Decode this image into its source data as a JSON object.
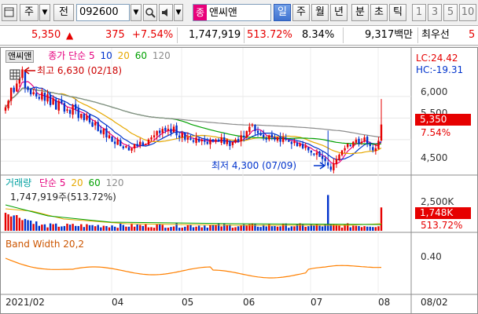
{
  "toolbar": {
    "window_icon": "chart-window-icon",
    "chart_type_label": "주",
    "market_label": "전",
    "stock_code": "092600",
    "search_icon": "magnifier-icon",
    "sound_icon": "speaker-icon",
    "badge": "종",
    "stock_name": "앤씨앤",
    "periods": [
      "일",
      "주",
      "월",
      "년",
      "분",
      "초",
      "틱"
    ],
    "selected_period": "일",
    "minute_options": [
      "1",
      "3",
      "5",
      "10"
    ]
  },
  "info": {
    "price": "5,350",
    "change_arrow": "▲",
    "change": "375",
    "change_pct": "+7.54%",
    "volume": "1,747,919",
    "volume_ratio": "513.72%",
    "turnover": "8.34%",
    "amount": "9,317백만",
    "priority_label": "최우선",
    "priority_value": "5"
  },
  "price_panel": {
    "stock_tag": "앤씨앤",
    "legend_prefix": "종가 단순",
    "ma_periods": [
      "5",
      "10",
      "20",
      "60",
      "120"
    ],
    "ma_colors": [
      "#e6007e",
      "#0033cc",
      "#e6a800",
      "#00a000",
      "#8c8c8c"
    ],
    "high_note": "최고 6,630 (02/18)",
    "low_note": "최저 4,300 (07/09)",
    "lc": "LC:24.42",
    "hc": "HC:-19.31",
    "axis_ticks": [
      "6,000",
      "5,500",
      "4,500"
    ],
    "current_price": "5,350",
    "current_pct": "7.54%"
  },
  "volume_panel": {
    "title": "거래량",
    "legend_prefix": "단순",
    "ma_periods": [
      "5",
      "20",
      "60",
      "120"
    ],
    "current_volume_label": "1,747,919주(513.72%)",
    "axis_tick": "2,500K",
    "current_volume_tag": "1,748K",
    "current_ratio": "513.72%"
  },
  "bandwidth_panel": {
    "title": "Band Width 20,2",
    "axis_tick": "0.40"
  },
  "x_axis": {
    "labels": [
      "2021/02",
      "04",
      "05",
      "06",
      "07",
      "08",
      "08/02"
    ]
  },
  "colors": {
    "up": "#e60000",
    "down": "#0033cc",
    "selected_period_bg": "#3f72d0",
    "price_tag_bg": "#e60000",
    "bandwidth_line": "#ff8000"
  },
  "chart_data": [
    {
      "type": "candlestick",
      "name": "price",
      "x_range": [
        "2021/02",
        "2021/08"
      ],
      "ylim": [
        4250,
        6800
      ],
      "closes": [
        5750,
        5900,
        6200,
        6100,
        6300,
        6450,
        6630,
        6200,
        6150,
        6050,
        6100,
        6000,
        5950,
        6100,
        5900,
        6050,
        5800,
        5950,
        5700,
        5900,
        5850,
        5650,
        5700,
        5600,
        5800,
        5700,
        5500,
        5600,
        5450,
        5550,
        5400,
        5300,
        5400,
        5200,
        5150,
        5250,
        5050,
        5100,
        4950,
        4900,
        5000,
        4850,
        4800,
        4850,
        4750,
        4800,
        4900,
        4850,
        4950,
        4850,
        4900,
        5000,
        5050,
        5100,
        5200,
        5150,
        5250,
        5200,
        5250,
        5150,
        5300,
        5100,
        5050,
        5150,
        5000,
        5050,
        5000,
        4950,
        5050,
        4950,
        5000,
        4950,
        4900,
        5000,
        4950,
        5000,
        4950,
        5050,
        4900,
        5000,
        4850,
        4950,
        5000,
        4950,
        5100,
        5050,
        5200,
        5300,
        5350,
        5200,
        5150,
        5100,
        5050,
        5000,
        5100,
        5050,
        5000,
        5050,
        4950,
        5050,
        5000,
        4950,
        4900,
        4950,
        4850,
        4900,
        4800,
        4850,
        4750,
        4700,
        4650,
        4700,
        4600,
        4550,
        4500,
        4400,
        4300,
        4450,
        4550,
        4650,
        4750,
        4800,
        4900,
        4850,
        4950,
        5000,
        4900,
        4950,
        5050,
        4900,
        4850,
        4750,
        4800,
        4975,
        5350
      ],
      "moving_averages": [
        "5",
        "10",
        "20",
        "60",
        "120"
      ]
    },
    {
      "type": "bar",
      "name": "volume",
      "latest_value": 1747919,
      "unit": "주"
    },
    {
      "type": "line",
      "name": "Band Width 20,2"
    }
  ]
}
